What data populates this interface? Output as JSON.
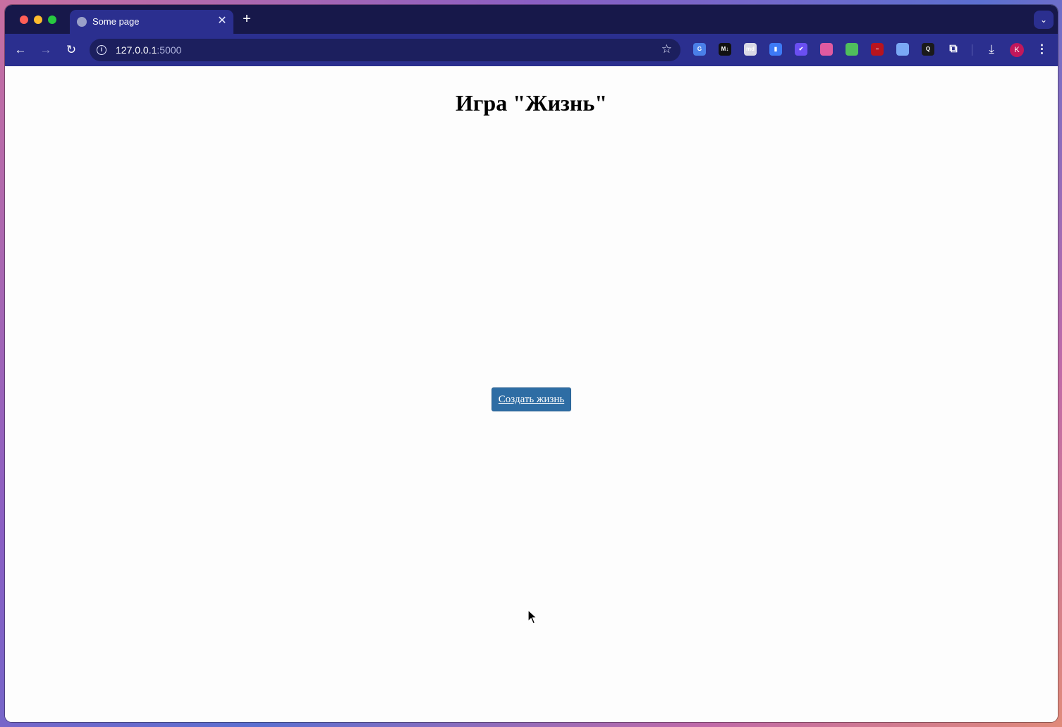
{
  "browser": {
    "tab": {
      "title": "Some page",
      "close_glyph": "✕"
    },
    "new_tab_glyph": "+",
    "tab_search_glyph": "⌄",
    "nav": {
      "back_glyph": "←",
      "forward_glyph": "→",
      "reload_glyph": "↻"
    },
    "url": {
      "host": "127.0.0.1",
      "port": ":5000"
    },
    "bookmark_glyph": "☆",
    "extensions": [
      {
        "icon": "google-translate-icon",
        "color": "#4a7fe8",
        "glyph": "G"
      },
      {
        "icon": "markdown-icon",
        "color": "#111111",
        "glyph": "M↓"
      },
      {
        "icon": "md-icon",
        "color": "#d9d9e6",
        "glyph": "md"
      },
      {
        "icon": "bookmark-extension-icon",
        "color": "#3d7af5",
        "glyph": "▮"
      },
      {
        "icon": "check-extension-icon",
        "color": "#6a4ff2",
        "glyph": "✔"
      },
      {
        "icon": "gradient-extension-icon",
        "color": "#e05aa0",
        "glyph": ""
      },
      {
        "icon": "pen-extension-icon",
        "color": "#4fbf5c",
        "glyph": ""
      },
      {
        "icon": "block-extension-icon",
        "color": "#b8141e",
        "glyph": "−"
      },
      {
        "icon": "window-extension-icon",
        "color": "#7aa8f5",
        "glyph": ""
      },
      {
        "icon": "search-extension-icon",
        "color": "#1a1a1a",
        "glyph": "Q"
      },
      {
        "icon": "puzzle-icon",
        "color": "transparent",
        "glyph": "⧉"
      }
    ],
    "download_glyph": "⤓",
    "avatar_letter": "K",
    "menu_glyph": "⋮"
  },
  "page": {
    "title": "Игра \"Жизнь\"",
    "create_button_label": "Создать жизнь"
  },
  "colors": {
    "tabbar": "#17184a",
    "toolbar": "#2b2f8f",
    "button": "#2e6da4"
  }
}
